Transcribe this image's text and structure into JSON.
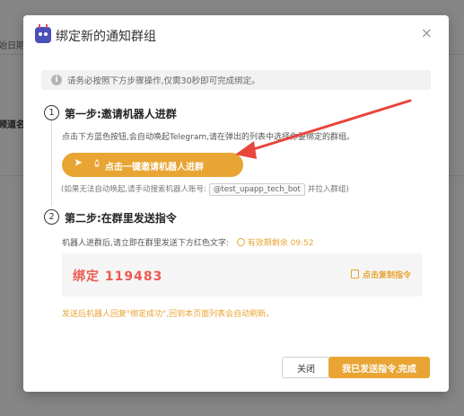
{
  "background": {
    "fragment_top": "始日期",
    "fragment_mid": "频道名"
  },
  "modal": {
    "title": "绑定新的通知群组",
    "close_glyph": "×",
    "notice": "请务必按照下方步骤操作,仅需30秒即可完成绑定。",
    "step1": {
      "number": "1",
      "title": "第一步:邀请机器人进群",
      "desc": "点击下方蓝色按钮,会自动唤起Telegram,请在弹出的列表中选择你要绑定的群组。",
      "button_label": "点击一键邀请机器人进群",
      "hint_prefix": "(如果无法自动唤起,请手动搜索机器人账号:",
      "bot_account": "@test_upapp_tech_bot",
      "hint_suffix": "并拉入群组)"
    },
    "step2": {
      "number": "2",
      "title": "第二步:在群里发送指令",
      "desc": "机器人进群后,请立即在群里发送下方红色文字:",
      "timer": "有效期剩余 09:52",
      "command": "绑定 119483",
      "copy_label": "点击复制指令",
      "after": "发送后机器人回复\"绑定成功\",回到本页面列表会自动刷新。"
    },
    "buttons": {
      "close": "关闭",
      "done": "我已发送指令,完成"
    }
  },
  "colors": {
    "accent": "#e8a534",
    "command_red": "#ec5a50",
    "annotation_arrow": "#e8453c"
  }
}
